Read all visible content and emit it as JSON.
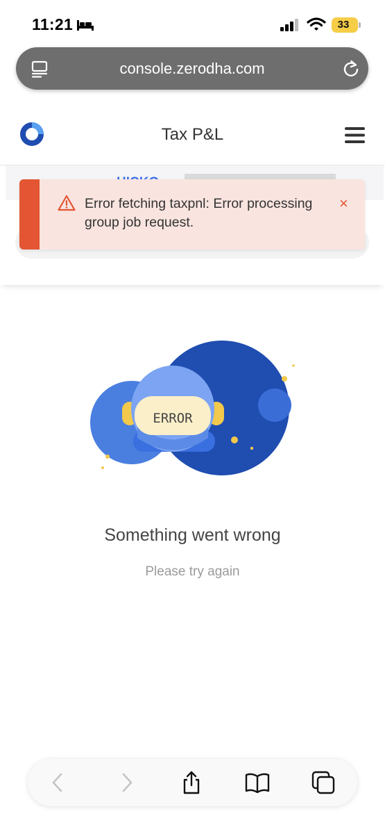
{
  "status_bar": {
    "time": "11:21",
    "battery": "33",
    "icons": [
      "bed-icon",
      "signal-icon",
      "wifi-icon",
      "battery-icon"
    ]
  },
  "browser": {
    "url": "console.zerodha.com",
    "icons": [
      "reader-icon",
      "reload-icon"
    ]
  },
  "header": {
    "title": "Tax P&L",
    "icons": [
      "console-logo",
      "menu-icon"
    ]
  },
  "background_content": {
    "partner_label": "HICKO"
  },
  "toast": {
    "message": "Error fetching taxpnl: Error processing group job request.",
    "close": "×",
    "accent_color": "#e35533",
    "background_color": "#f9e4df"
  },
  "illustration": {
    "visor_text": "ERROR",
    "colors": {
      "dark_blue": "#1f4db0",
      "mid_blue": "#4a7fe0",
      "visor": "#fbefc9",
      "gold": "#f2c94c"
    }
  },
  "error_state": {
    "title": "Something went wrong",
    "subtitle": "Please try again"
  },
  "toolbar": {
    "icons": [
      "back-icon",
      "forward-icon",
      "share-icon",
      "bookmarks-icon",
      "tabs-icon"
    ]
  }
}
